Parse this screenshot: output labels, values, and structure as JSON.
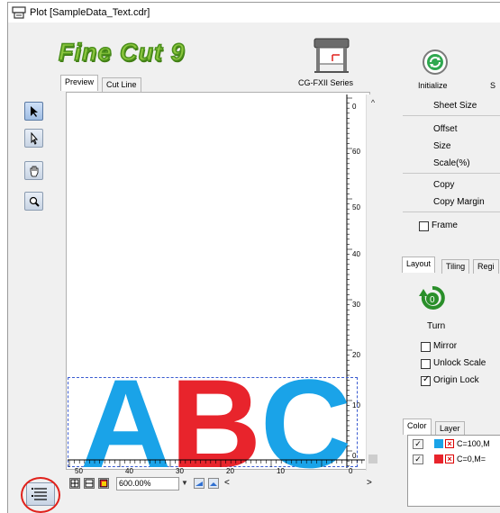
{
  "window": {
    "title": "Plot [SampleData_Text.cdr]"
  },
  "header": {
    "logo_text": "Fine Cut 9",
    "model_label": "CG-FXII Series",
    "initialize_label": "Initialize",
    "clipped_label": "S"
  },
  "preview_tabs": [
    {
      "label": "Preview",
      "active": true
    },
    {
      "label": "Cut Line",
      "active": false
    }
  ],
  "tools": [
    {
      "name": "select-arrow-icon",
      "active": true
    },
    {
      "name": "node-arrow-icon",
      "active": false
    },
    {
      "name": "hand-pan-icon",
      "active": false
    },
    {
      "name": "zoom-magnifier-icon",
      "active": false
    }
  ],
  "preview": {
    "letters": [
      "A",
      "B",
      "C"
    ],
    "letter_colors": [
      "#1aa3e8",
      "#e8242c",
      "#1aa3e8"
    ],
    "vertical_ruler_labels": [
      "0",
      "60",
      "50",
      "40",
      "30",
      "20",
      "10",
      "0"
    ],
    "horizontal_ruler_labels": [
      "50",
      "40",
      "30",
      "20",
      "10",
      "0"
    ]
  },
  "zoom": {
    "value": "600.00%"
  },
  "settings": {
    "sheet_size_label": "Sheet Size",
    "offset_label": "Offset",
    "size_label": "Size",
    "scale_label": "Scale(%)",
    "copy_label": "Copy",
    "copy_margin_label": "Copy Margin",
    "frame_label": "Frame",
    "frame_checked": false
  },
  "layout_tabs": [
    {
      "label": "Layout",
      "active": true
    },
    {
      "label": "Tiling",
      "active": false
    },
    {
      "label": "Regi",
      "active": false
    }
  ],
  "layout": {
    "turn_value": "0",
    "turn_label": "Turn",
    "mirror_label": "Mirror",
    "mirror_checked": false,
    "unlock_scale_label": "Unlock Scale",
    "unlock_scale_checked": false,
    "origin_lock_label": "Origin Lock",
    "origin_lock_checked": true
  },
  "color_tabs": [
    {
      "label": "Color",
      "active": true
    },
    {
      "label": "Layer",
      "active": false
    }
  ],
  "color_list": [
    {
      "label": "C=100,M",
      "swatch": "#1aa3e8",
      "checked": true
    },
    {
      "label": "C=0,M=",
      "swatch": "#e8242c",
      "checked": true
    }
  ],
  "colors": {
    "accent_green": "#8cc63f",
    "highlight_circle": "#e0201a",
    "selection_dash": "#3a5bd0"
  }
}
